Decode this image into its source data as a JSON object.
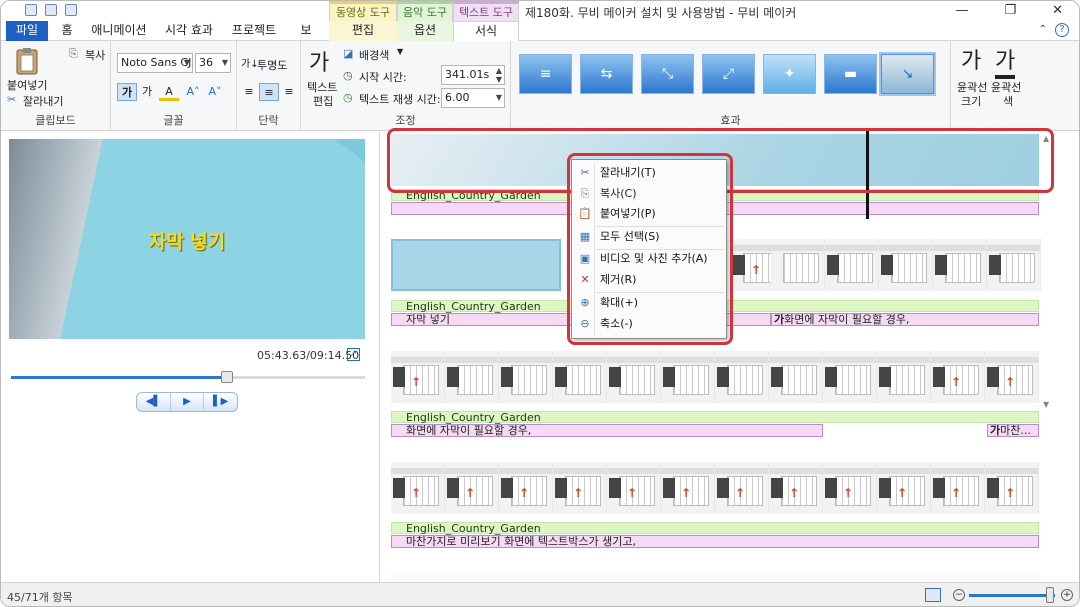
{
  "window": {
    "title": "제180화. 무비 메이커 설치 및 사용방법 - 무비 메이커",
    "context_groups": {
      "video": "동영상 도구",
      "music": "음악 도구",
      "text": "텍스트 도구"
    },
    "controls": {
      "minimize": "—",
      "restore": "❐",
      "close": "✕"
    }
  },
  "tabs": {
    "file": "파일",
    "home": "홈",
    "animation": "애니메이션",
    "visual_effects": "시각 효과",
    "project": "프로젝트",
    "view": "보기",
    "edit": "편집",
    "options": "옵션",
    "format": "서식"
  },
  "ribbon": {
    "clipboard": {
      "paste": "붙여넣기",
      "copy": "복사",
      "cut": "잘라내기",
      "label": "클립보드"
    },
    "font": {
      "name": "Noto Sans CJk",
      "size": "36",
      "bold": "가",
      "italic": "가",
      "label": "글꼴"
    },
    "paragraph": {
      "transparency": "투명도",
      "label": "단락"
    },
    "adjust": {
      "text_edit_line1": "텍스트",
      "text_edit_line2": "편집",
      "bg_color": "배경색",
      "start_time_label": "시작 시간:",
      "start_time_value": "341.01s",
      "duration_label": "텍스트 재생 시간:",
      "duration_value": "6.00",
      "label": "조정"
    },
    "effects": {
      "label": "효과"
    },
    "outline": {
      "size_line1": "윤곽선",
      "size_line2": "크기",
      "color_line1": "윤곽선",
      "color_line2": "색",
      "glyph_size": "가",
      "glyph_color": "가"
    }
  },
  "preview": {
    "caption": "자막 넣기",
    "timecode": "05:43.63/09:14.50",
    "seek_progress": 0.61,
    "buttons": {
      "prev": "◀▌",
      "play": "▶",
      "next": "▌▶"
    }
  },
  "storyboard": {
    "rows": [
      {
        "audio": "English_Country_Garden",
        "subtitles": []
      },
      {
        "audio": "English_Country_Garden",
        "subtitles": [
          "자막 넣기",
          "화면에 자막이 필요할 경우,"
        ]
      },
      {
        "audio": "English_Country_Garden",
        "subtitles": [
          "화면에 자막이 필요할 경우,",
          "마찬..."
        ]
      },
      {
        "audio": "English_Country_Garden",
        "subtitles": [
          "마찬가지로 미리보기 화면에 텍스트박스가 생기고,"
        ]
      }
    ],
    "text_marker": "가"
  },
  "context_menu": {
    "items": [
      {
        "icon": "scissors-icon",
        "glyph": "✂",
        "label": "잘라내기(T)"
      },
      {
        "icon": "copy-icon",
        "glyph": "⎘",
        "label": "복사(C)"
      },
      {
        "icon": "paste-icon",
        "glyph": "📋",
        "label": "붙여넣기(P)"
      },
      {
        "icon": "select-all-icon",
        "glyph": "▦",
        "label": "모두 선택(S)"
      },
      {
        "icon": "add-media-icon",
        "glyph": "▣",
        "label": "비디오 및 사진 추가(A)"
      },
      {
        "icon": "remove-icon",
        "glyph": "✕",
        "label": "제거(R)"
      },
      {
        "icon": "zoom-in-icon",
        "glyph": "⊕",
        "label": "확대(+)"
      },
      {
        "icon": "zoom-out-icon",
        "glyph": "⊖",
        "label": "축소(-)"
      }
    ],
    "remove_color": "#d0343c"
  },
  "status": {
    "items": "45/71개 항목",
    "zoom_out": "−",
    "zoom_in": "+"
  },
  "colors": {
    "accent": "#1e5fc4",
    "highlight": "#d0343c",
    "caption": "#f5df1a"
  }
}
